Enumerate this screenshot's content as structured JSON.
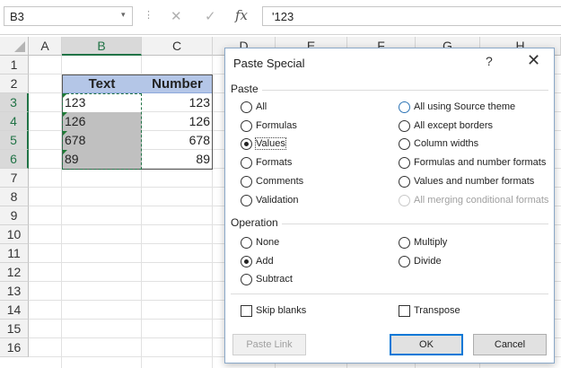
{
  "formula_bar": {
    "name_box": "B3",
    "name_box_arrow": "▾",
    "dots": "⋮",
    "cancel": "✕",
    "enter": "✓",
    "fx": "fx",
    "value": "'123"
  },
  "sheet": {
    "columns": [
      "A",
      "B",
      "C",
      "D",
      "E",
      "F",
      "G",
      "H"
    ],
    "rows": [
      "1",
      "2",
      "3",
      "4",
      "5",
      "6",
      "7",
      "8",
      "9",
      "10",
      "11",
      "12",
      "13",
      "14",
      "15",
      "16"
    ],
    "header_text": "Text",
    "header_number": "Number",
    "text_values": [
      "123",
      "126",
      "678",
      "89"
    ],
    "number_values": [
      "123",
      "126",
      "678",
      "89"
    ]
  },
  "dialog": {
    "title": "Paste Special",
    "help": "?",
    "close": "✕",
    "paste_label": "Paste",
    "paste_options_left": [
      "All",
      "Formulas",
      "Values",
      "Formats",
      "Comments",
      "Validation"
    ],
    "paste_options_right": [
      "All using Source theme",
      "All except borders",
      "Column widths",
      "Formulas and number formats",
      "Values and number formats",
      "All merging conditional formats"
    ],
    "operation_label": "Operation",
    "operation_left": [
      "None",
      "Add",
      "Subtract"
    ],
    "operation_right": [
      "Multiply",
      "Divide"
    ],
    "skip_blanks": "Skip blanks",
    "transpose": "Transpose",
    "paste_link": "Paste Link",
    "ok": "OK",
    "cancel": "Cancel"
  }
}
